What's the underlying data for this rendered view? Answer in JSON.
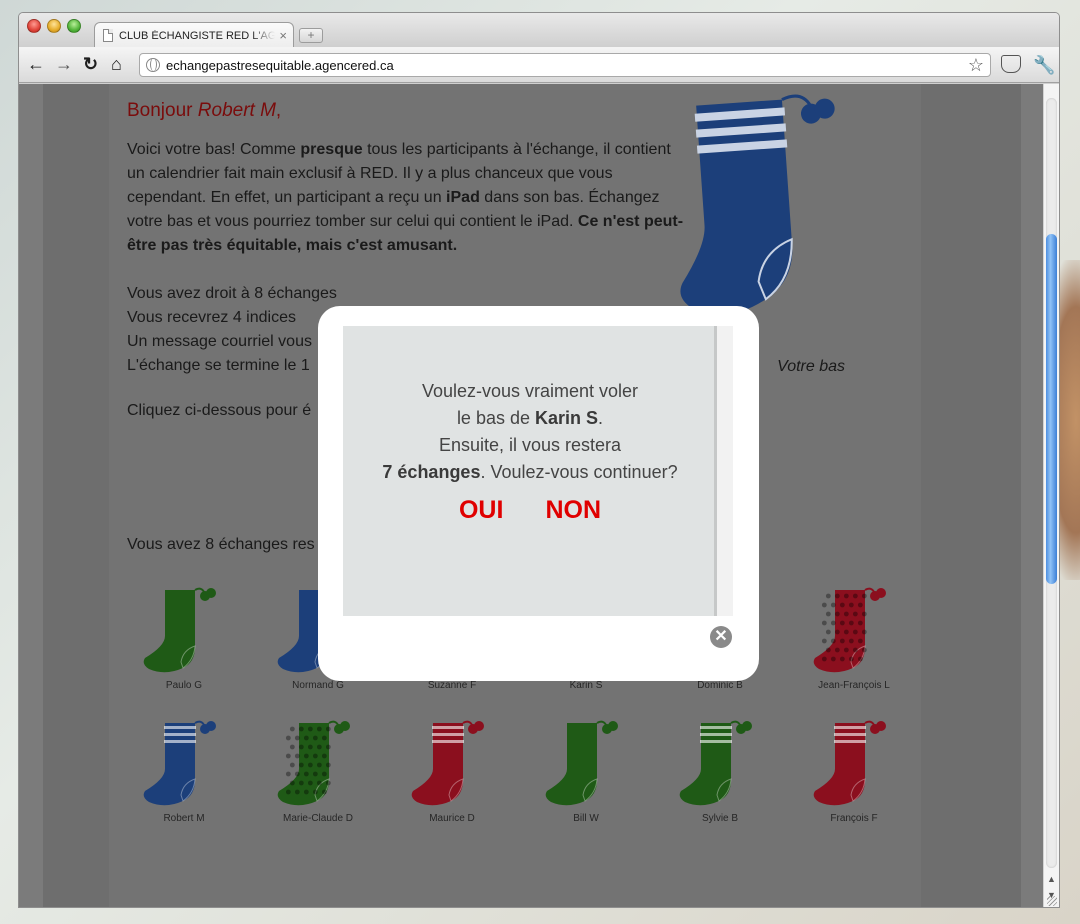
{
  "browser": {
    "tab_title": "CLUB ÉCHANGISTE RED L'AGENCE",
    "tab_close": "×",
    "new_tab": "+",
    "url": "echangepastresequitable.agencered.ca",
    "back_icon": "←",
    "forward_icon": "→",
    "reload_icon": "↻",
    "home_icon": "⌂",
    "star_icon": "☆",
    "wrench_icon": "🔧"
  },
  "page": {
    "greeting_prefix": "Bonjour ",
    "greeting_name": "Robert M",
    "greeting_suffix": ",",
    "intro_1": "Voici votre bas! Comme ",
    "intro_bold_1": "presque",
    "intro_2": " tous les participants à l'échange, il contient un calendrier fait main exclusif à RED. Il y a plus chanceux que vous cependant. En effet, un participant a reçu un ",
    "intro_bold_2": "iPad",
    "intro_3": " dans son bas. Échangez votre bas et vous pourriez tomber sur celui qui contient le iPad. ",
    "intro_bold_3": "Ce n'est peut-être pas très équitable, mais c'est amusant.",
    "rule_1": "Vous avez droit à 8 échanges",
    "rule_2": "Vous recevrez 4 indices",
    "rule_3": "Un message courriel vous",
    "rule_4": "L'échange se termine le 1",
    "cta": "Cliquez ci-dessous pour é",
    "remaining": "Vous avez 8 échanges res",
    "your_stocking_caption": "Votre bas"
  },
  "stockings": [
    {
      "name": "Paulo G",
      "color": "#1f5a16",
      "pattern": "plain"
    },
    {
      "name": "Normand G",
      "color": "#1c3f7a",
      "pattern": "plain"
    },
    {
      "name": "Suzanne F",
      "color": "#8b0f1e",
      "pattern": "plain"
    },
    {
      "name": "Karin S",
      "color": "#1c3f7a",
      "pattern": "plain"
    },
    {
      "name": "Dominic B",
      "color": "#1f5a16",
      "pattern": "plain"
    },
    {
      "name": "Jean-François L",
      "color": "#8b0f1e",
      "pattern": "dots"
    },
    {
      "name": "Robert M",
      "color": "#1c3f7a",
      "pattern": "stripes"
    },
    {
      "name": "Marie-Claude D",
      "color": "#1f5a16",
      "pattern": "dots"
    },
    {
      "name": "Maurice D",
      "color": "#8b0f1e",
      "pattern": "stripes"
    },
    {
      "name": "Bill W",
      "color": "#1f5a16",
      "pattern": "plain"
    },
    {
      "name": "Sylvie B",
      "color": "#1f5a16",
      "pattern": "stripes"
    },
    {
      "name": "François F",
      "color": "#8b0f1e",
      "pattern": "stripes"
    }
  ],
  "modal": {
    "line_1": "Voulez-vous vraiment voler",
    "line_2_prefix": "le bas de ",
    "line_2_bold": "Karin S",
    "line_2_suffix": ".",
    "line_3": "Ensuite, il vous restera",
    "line_4_bold": "7 échanges",
    "line_4_suffix": ". Voulez-vous continuer?",
    "yes_label": "OUI",
    "no_label": "NON",
    "close_icon": "✕"
  },
  "colors": {
    "greeting": "#7a0c0c",
    "action_red": "#e00000",
    "stocking_main": "#1c3f7a"
  }
}
